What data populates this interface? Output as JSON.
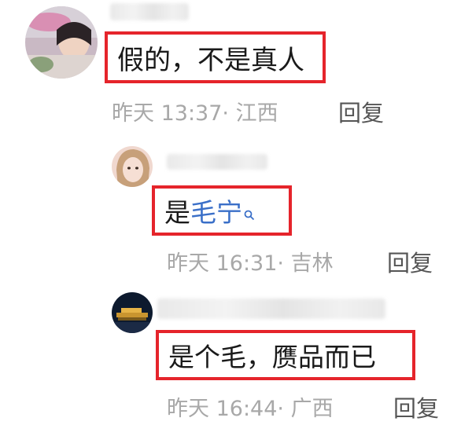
{
  "comments": [
    {
      "text": "假的，不是真人",
      "time": "昨天 13:37",
      "location": "· 江西",
      "reply_label": "回复"
    },
    {
      "text_plain": "是",
      "text_link": "毛宁",
      "time": "昨天 16:31",
      "location": "· 吉林",
      "reply_label": "回复"
    },
    {
      "text": "是个毛，赝品而已",
      "time": "昨天 16:44",
      "location": "· 广西",
      "reply_label": "回复"
    }
  ],
  "colors": {
    "highlight_border": "#e5242b",
    "link": "#3a6fc8",
    "meta_text": "#a8a8a8"
  }
}
